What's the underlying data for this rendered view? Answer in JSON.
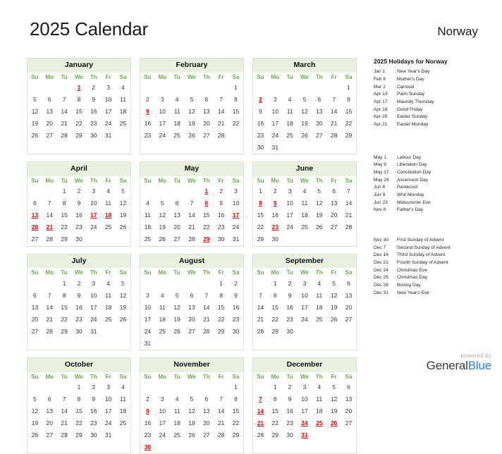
{
  "header": {
    "title": "2025 Calendar",
    "country": "Norway"
  },
  "weekdays": [
    "Su",
    "Mo",
    "Tu",
    "We",
    "Th",
    "Fr",
    "Sa"
  ],
  "months": [
    {
      "name": "January",
      "first_weekday": 3,
      "days": 31,
      "holidays": [
        1
      ]
    },
    {
      "name": "February",
      "first_weekday": 6,
      "days": 28,
      "holidays": [
        9
      ]
    },
    {
      "name": "March",
      "first_weekday": 6,
      "days": 31,
      "holidays": [
        2
      ]
    },
    {
      "name": "April",
      "first_weekday": 2,
      "days": 30,
      "holidays": [
        13,
        17,
        18,
        20,
        21
      ]
    },
    {
      "name": "May",
      "first_weekday": 4,
      "days": 31,
      "holidays": [
        1,
        8,
        17,
        29
      ]
    },
    {
      "name": "June",
      "first_weekday": 0,
      "days": 30,
      "holidays": [
        8,
        9,
        23
      ]
    },
    {
      "name": "July",
      "first_weekday": 2,
      "days": 31,
      "holidays": []
    },
    {
      "name": "August",
      "first_weekday": 5,
      "days": 31,
      "holidays": []
    },
    {
      "name": "September",
      "first_weekday": 1,
      "days": 30,
      "holidays": []
    },
    {
      "name": "October",
      "first_weekday": 3,
      "days": 31,
      "holidays": []
    },
    {
      "name": "November",
      "first_weekday": 6,
      "days": 30,
      "holidays": [
        9,
        30
      ]
    },
    {
      "name": "December",
      "first_weekday": 1,
      "days": 31,
      "holidays": [
        7,
        14,
        21,
        24,
        25,
        26,
        31
      ]
    }
  ],
  "holidays_panel": {
    "title": "2025 Holidays for Norway",
    "groups": [
      [
        {
          "date": "Jan 1",
          "name": "New Year's Day"
        },
        {
          "date": "Feb 9",
          "name": "Mother's Day"
        },
        {
          "date": "Mar 2",
          "name": "Carnival"
        },
        {
          "date": "Apr 13",
          "name": "Palm Sunday"
        },
        {
          "date": "Apr 17",
          "name": "Maundy Thursday"
        },
        {
          "date": "Apr 18",
          "name": "Good Friday"
        },
        {
          "date": "Apr 20",
          "name": "Easter Sunday"
        },
        {
          "date": "Apr 21",
          "name": "Easter Monday"
        }
      ],
      [
        {
          "date": "May 1",
          "name": "Labour Day"
        },
        {
          "date": "May 8",
          "name": "Liberation Day"
        },
        {
          "date": "May 17",
          "name": "Constitution Day"
        },
        {
          "date": "May 29",
          "name": "Ascension Day"
        },
        {
          "date": "Jun 8",
          "name": "Pentecost"
        },
        {
          "date": "Jun 9",
          "name": "Whit Monday"
        },
        {
          "date": "Jun 23",
          "name": "Midsummer Eve"
        },
        {
          "date": "Nov 9",
          "name": "Father's Day"
        }
      ],
      [
        {
          "date": "Nov 30",
          "name": "First Sunday of Advent"
        },
        {
          "date": "Dec 7",
          "name": "Second Sunday of Advent"
        },
        {
          "date": "Dec 14",
          "name": "Third Sunday of Advent"
        },
        {
          "date": "Dec 21",
          "name": "Fourth Sunday of Advent"
        },
        {
          "date": "Dec 24",
          "name": "Christmas Eve"
        },
        {
          "date": "Dec 25",
          "name": "Christmas Day"
        },
        {
          "date": "Dec 26",
          "name": "Boxing Day"
        },
        {
          "date": "Dec 31",
          "name": "New Year's Eve"
        }
      ]
    ]
  },
  "footer": {
    "powered_by": "powered by",
    "brand_first": "General",
    "brand_second": "Blue"
  },
  "colors": {
    "holiday": "#e00000",
    "weekday_label": "#6aa84f",
    "month_header_bg": "#e9f0e0",
    "brand_blue": "#2a7fd4"
  }
}
